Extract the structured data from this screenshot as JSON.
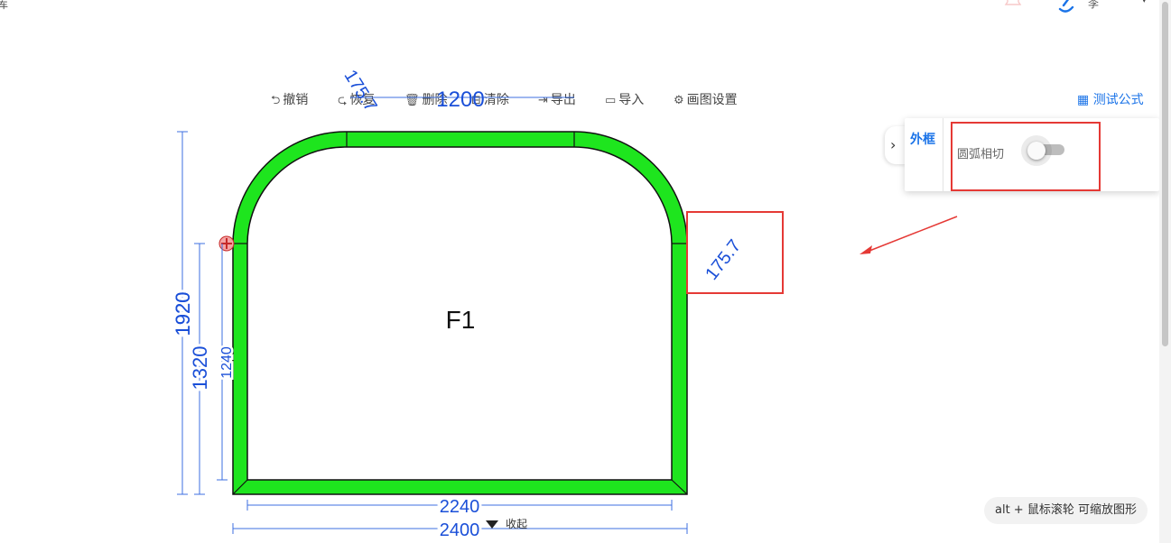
{
  "header": {
    "left_fragment": "库",
    "user_name": "李",
    "caret": "▾"
  },
  "toolbar": {
    "undo": "撤销",
    "redo": "恢复",
    "delete": "删除",
    "clear": "清除",
    "export": "导出",
    "import": "导入",
    "draw_settings": "画图设置",
    "test_formula": "测试公式"
  },
  "side_panel": {
    "tab_label": "外框",
    "arc_tangent_label": "圆弧相切",
    "arc_tangent_enabled": false,
    "expand_arrow": "›"
  },
  "drawing": {
    "frame_color": "#1ee51e",
    "label": "F1",
    "dims": {
      "top_width": "1200",
      "top_left_arc": "175.7",
      "right_arc": "175.7",
      "overall_height": "1920",
      "side_height": "1320",
      "inner_height": "1240",
      "inner_width": "2240",
      "overall_width": "2400"
    }
  },
  "footer": {
    "collapse": "收起",
    "zoom_hint": "alt + 鼠标滚轮 可缩放图形"
  },
  "colors": {
    "accent": "#1a73e8",
    "dimension": "#1a4fd8",
    "highlight": "#e53935"
  }
}
